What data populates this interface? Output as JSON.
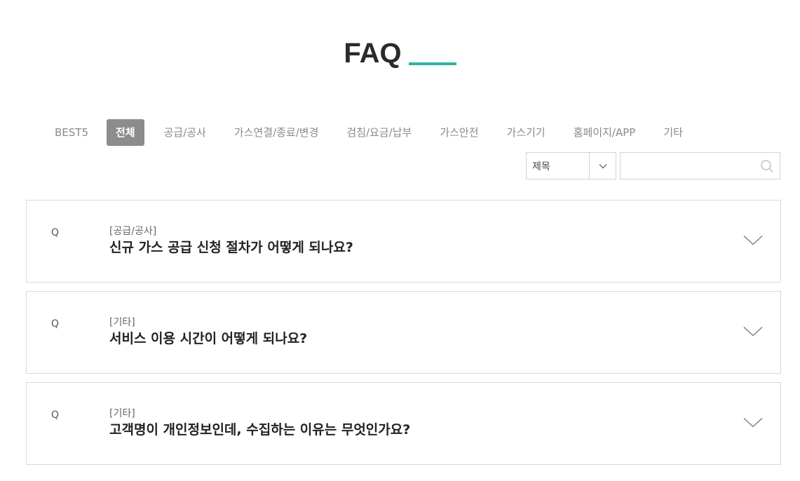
{
  "header": {
    "title": "FAQ",
    "accent_color": "#2fb3a5"
  },
  "tabs": [
    {
      "label": "BEST5",
      "active": false
    },
    {
      "label": "전체",
      "active": true
    },
    {
      "label": "공급/공사",
      "active": false
    },
    {
      "label": "가스연결/종료/변경",
      "active": false
    },
    {
      "label": "검침/요금/납부",
      "active": false
    },
    {
      "label": "가스안전",
      "active": false
    },
    {
      "label": "가스기기",
      "active": false
    },
    {
      "label": "홈페이지/APP",
      "active": false
    },
    {
      "label": "기타",
      "active": false
    }
  ],
  "search": {
    "select_value": "제목",
    "placeholder": "",
    "icons": {
      "select": "chevron-down-icon",
      "search": "search-icon"
    }
  },
  "faq": {
    "q_label": "Q",
    "items": [
      {
        "category": "[공급/공사]",
        "question": "신규 가스 공급 신청 절차가 어떻게 되나요?"
      },
      {
        "category": "[기타]",
        "question": "서비스 이용 시간이 어떻게 되나요?"
      },
      {
        "category": "[기타]",
        "question": "고객명이 개인정보인데, 수집하는 이유는 무엇인가요?"
      }
    ],
    "toggle_icon": "chevron-down-icon"
  }
}
